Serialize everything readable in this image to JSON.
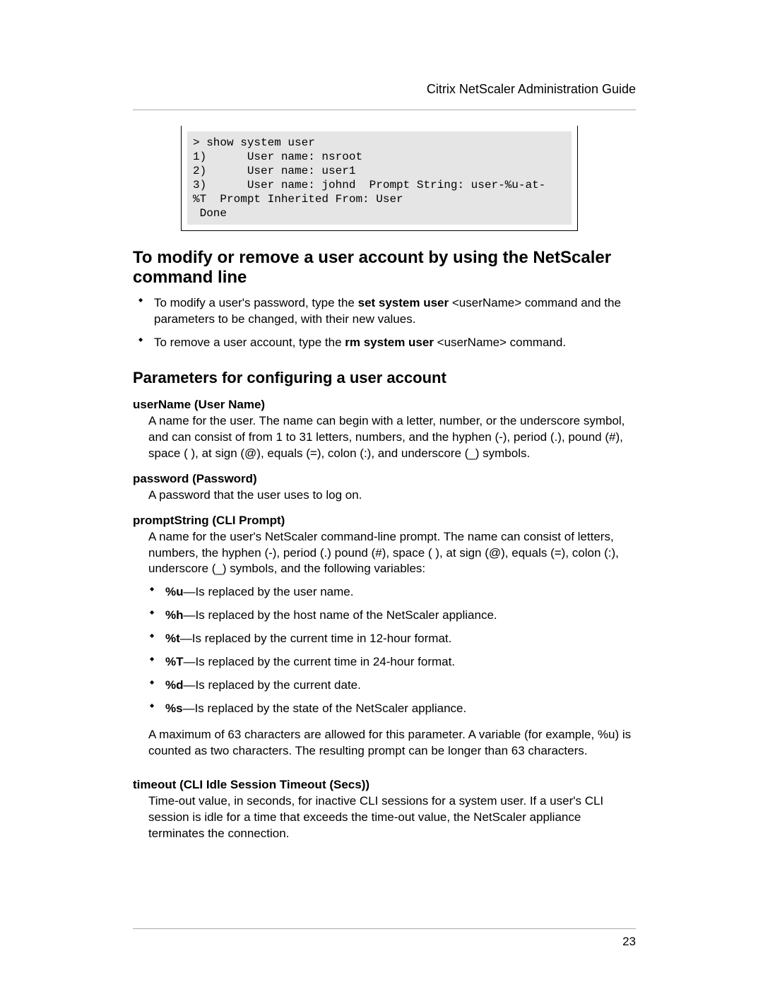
{
  "header": {
    "title": "Citrix NetScaler Administration Guide"
  },
  "code": {
    "text": "> show system user\n1)      User name: nsroot\n2)      User name: user1\n3)      User name: johnd  Prompt String: user-%u-at-\n%T  Prompt Inherited From: User\n Done"
  },
  "section1": {
    "heading": "To modify or remove a user account by using the NetScaler command line",
    "bullets": [
      {
        "pre": "To modify a user's password, type the ",
        "cmd": "set system user",
        "post": " <userName> command and the parameters to be changed, with their new values."
      },
      {
        "pre": "To remove a user account, type the ",
        "cmd": "rm system user",
        "post": " <userName> command."
      }
    ]
  },
  "section2": {
    "heading": "Parameters for configuring a user account",
    "params": {
      "userName": {
        "term": "userName (User Name)",
        "desc": "A name for the user. The name can begin with a letter, number, or the underscore symbol, and can consist of from 1 to 31 letters, numbers, and the hyphen (-), period (.), pound (#), space ( ), at sign (@), equals (=), colon (:), and underscore (_) symbols."
      },
      "password": {
        "term": "password (Password)",
        "desc": "A password that the user uses to log on."
      },
      "promptString": {
        "term": "promptString (CLI Prompt)",
        "desc": "A name for the user's NetScaler command-line prompt. The name can consist of letters, numbers, the hyphen (-), period (.) pound (#), space ( ), at sign (@), equals (=), colon (:), underscore (_) symbols, and the following variables:",
        "vars": [
          {
            "code": "%u",
            "text": "—Is replaced by the user name."
          },
          {
            "code": "%h",
            "text": "—Is replaced by the host name of the NetScaler appliance."
          },
          {
            "code": "%t",
            "text": "—Is replaced by the current time in 12-hour format."
          },
          {
            "code": "%T",
            "text": "—Is replaced by the current time in 24-hour format."
          },
          {
            "code": "%d",
            "text": "—Is replaced by the current date."
          },
          {
            "code": "%s",
            "text": "—Is replaced by the state of the NetScaler appliance."
          }
        ],
        "note": "A maximum of 63 characters are allowed for this parameter. A variable (for example, %u) is counted as two characters. The resulting prompt can be longer than 63 characters."
      },
      "timeout": {
        "term": "timeout (CLI Idle Session Timeout (Secs))",
        "desc": "Time-out value, in seconds, for inactive CLI sessions for a system user. If a user's CLI session is idle for a time that exceeds the time-out value, the NetScaler appliance terminates the connection."
      }
    }
  },
  "pageNumber": "23"
}
